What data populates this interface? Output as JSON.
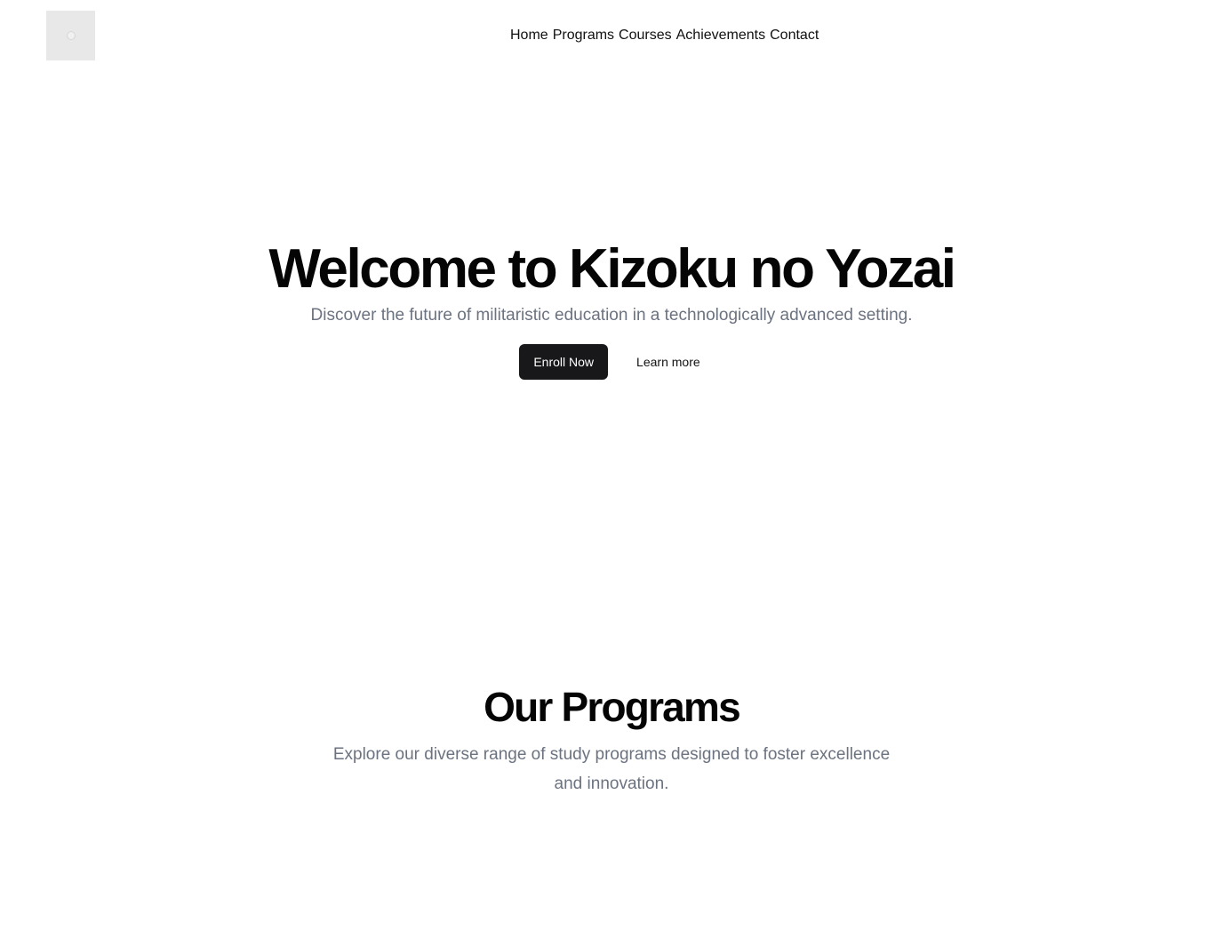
{
  "header": {
    "logo_icon": "logo-placeholder-icon",
    "nav": [
      {
        "label": "Home"
      },
      {
        "label": "Programs"
      },
      {
        "label": "Courses"
      },
      {
        "label": "Achievements"
      },
      {
        "label": "Contact"
      }
    ]
  },
  "hero": {
    "title": "Welcome to Kizoku no Yozai",
    "subtitle": "Discover the future of militaristic education in a technologically advanced setting.",
    "primary_button": "Enroll Now",
    "secondary_button": "Learn more"
  },
  "programs": {
    "title": "Our Programs",
    "subtitle": "Explore our diverse range of study programs designed to foster excellence and innovation."
  },
  "colors": {
    "primary_button_bg": "#18181b",
    "muted_text": "#6b7280",
    "logo_placeholder": "#e8e8e8"
  }
}
